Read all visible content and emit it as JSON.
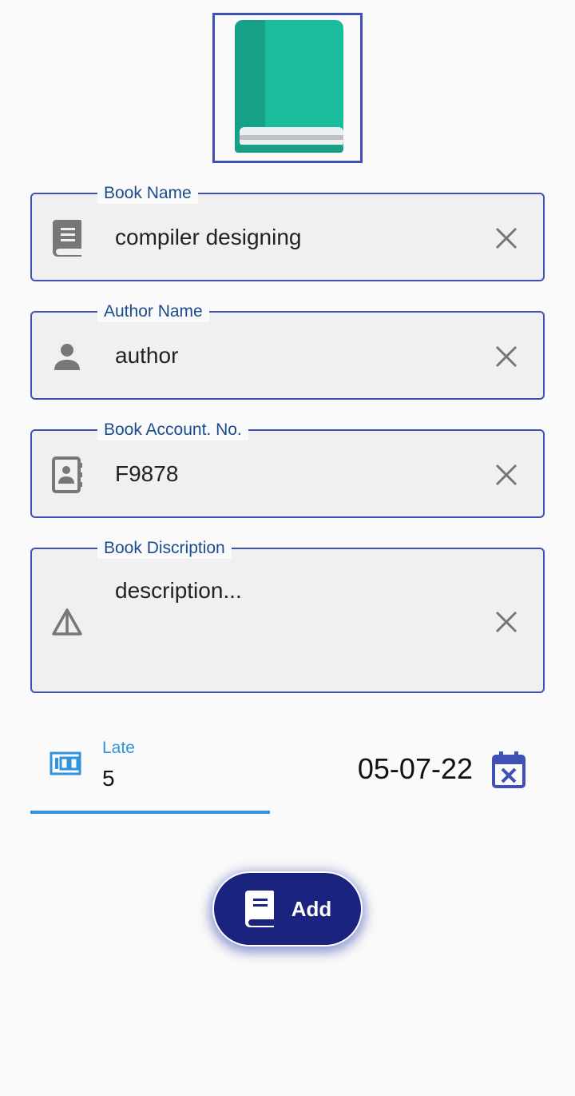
{
  "logo": {
    "icon": "book-icon",
    "color": "#1abc9c"
  },
  "fields": {
    "book_name": {
      "label": "Book Name",
      "value": "compiler designing",
      "icon": "book-icon"
    },
    "author_name": {
      "label": "Author Name",
      "value": "author",
      "icon": "person-icon"
    },
    "account_no": {
      "label": "Book Account. No.",
      "value": "F9878",
      "icon": "contact-book-icon"
    },
    "description": {
      "label": "Book Discription",
      "value": "description...",
      "icon": "warning-triangle-icon"
    }
  },
  "late": {
    "label": "Late",
    "value": "5",
    "icon": "counter-icon"
  },
  "date": {
    "value": "05-07-22",
    "icon": "calendar-cancel-icon"
  },
  "add_button": {
    "label": "Add",
    "icon": "book-icon"
  },
  "colors": {
    "accent": "#3f51b5",
    "label_text": "#1a4b8c",
    "late_blue": "#2f93dd",
    "button_bg": "#1a237e",
    "field_bg": "#f0f0f0",
    "icon_grey": "#777777"
  }
}
